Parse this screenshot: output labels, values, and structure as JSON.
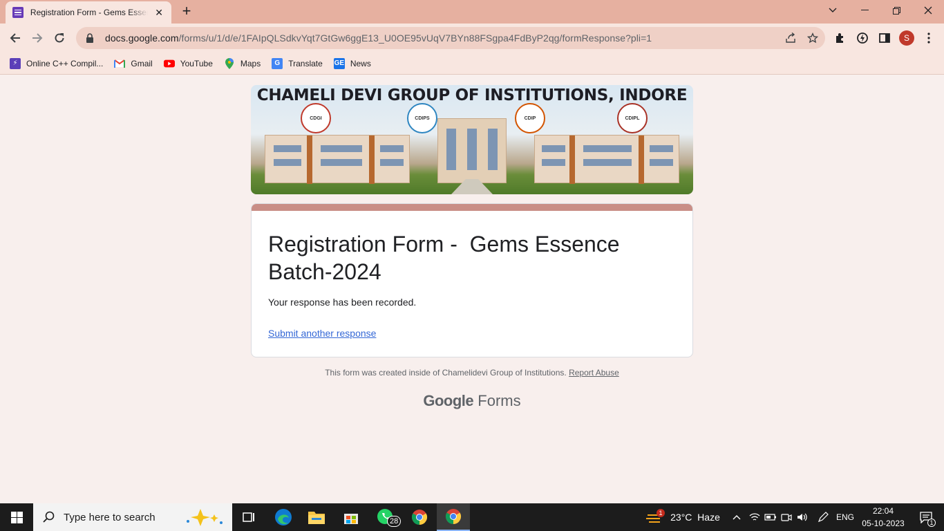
{
  "browser": {
    "tab_title": "Registration Form - Gems Essence Batch-2024",
    "url_host": "docs.google.com",
    "url_path": "/forms/u/1/d/e/1FAIpQLSdkvYqt7GtGw6ggE13_U0OE95vUqV7BYn88FSgpa4FdByP2qg/formResponse?pli=1",
    "profile_initial": "S",
    "bookmarks": [
      {
        "label": "Online C++ Compil...",
        "icon": "compiler-icon"
      },
      {
        "label": "Gmail",
        "icon": "gmail-icon"
      },
      {
        "label": "YouTube",
        "icon": "youtube-icon"
      },
      {
        "label": "Maps",
        "icon": "maps-icon"
      },
      {
        "label": "Translate",
        "icon": "translate-icon"
      },
      {
        "label": "News",
        "icon": "news-icon"
      }
    ]
  },
  "form": {
    "banner_title": "CHAMELI DEVI GROUP OF INSTITUTIONS, INDORE",
    "logos": [
      "CDGI",
      "CDIPS",
      "CDIP",
      "CDIPL"
    ],
    "title": "Registration Form -  Gems Essence Batch-2024",
    "confirmation": "Your response has been recorded.",
    "another_link": "Submit another response",
    "footer_text": "This form was created inside of Chamelidevi Group of Institutions.",
    "report_abuse": "Report Abuse",
    "brand_google": "Google",
    "brand_forms": "Forms",
    "accent_color": "#c98e86"
  },
  "taskbar": {
    "search_placeholder": "Type here to search",
    "whatsapp_badge": "28",
    "weather_badge": "1",
    "weather": "23°C  Haze",
    "language": "ENG",
    "time": "22:04",
    "date": "05-10-2023",
    "notification_count": "1"
  }
}
